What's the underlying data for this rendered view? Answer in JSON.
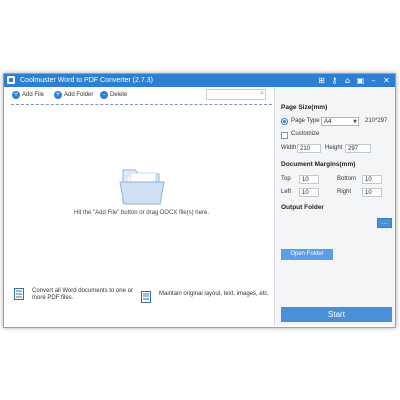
{
  "app": {
    "title": "Coolmuster Word to PDF Converter (2.7.3)"
  },
  "titlebar_icons": [
    {
      "name": "register-icon",
      "glyph": "⊞"
    },
    {
      "name": "key-icon",
      "glyph": "⚷"
    },
    {
      "name": "home-icon",
      "glyph": "⌂"
    },
    {
      "name": "feedback-icon",
      "glyph": "▣"
    },
    {
      "name": "minimize-icon",
      "glyph": "–"
    },
    {
      "name": "close-icon",
      "glyph": "✕"
    }
  ],
  "toolbar": {
    "add_file": "Add File",
    "add_folder": "Add Folder",
    "delete": "Delete",
    "search_placeholder": ""
  },
  "drop_area": {
    "hint": "Hit the \"Add File\" button or drag DOCX file(s) here."
  },
  "features": [
    {
      "text_line1": "Convert all Word documents to one or",
      "text_line2": "more PDF files."
    },
    {
      "text_line1": "Maintain original layout, text, images, etc.",
      "text_line2": ""
    }
  ],
  "settings": {
    "page_size_title": "Page Size(mm)",
    "page_type_label": "Page Type",
    "page_type_value": "A4",
    "page_type_dims": "210*297",
    "customize_label": "Customize",
    "width_label": "Width",
    "width_value": "210",
    "height_label": "Height",
    "height_value": "297",
    "margins_title": "Document Margins(mm)",
    "top_label": "Top",
    "top_value": "10",
    "bottom_label": "Bottom",
    "bottom_value": "10",
    "left_label": "Left",
    "left_value": "10",
    "right_label": "Right",
    "right_value": "10",
    "output_title": "Output Folder",
    "browse_label": "...",
    "open_folder_label": "Open Folder",
    "start_label": "Start"
  },
  "colors": {
    "accent": "#2d7fd3",
    "button": "#4a90d9"
  }
}
